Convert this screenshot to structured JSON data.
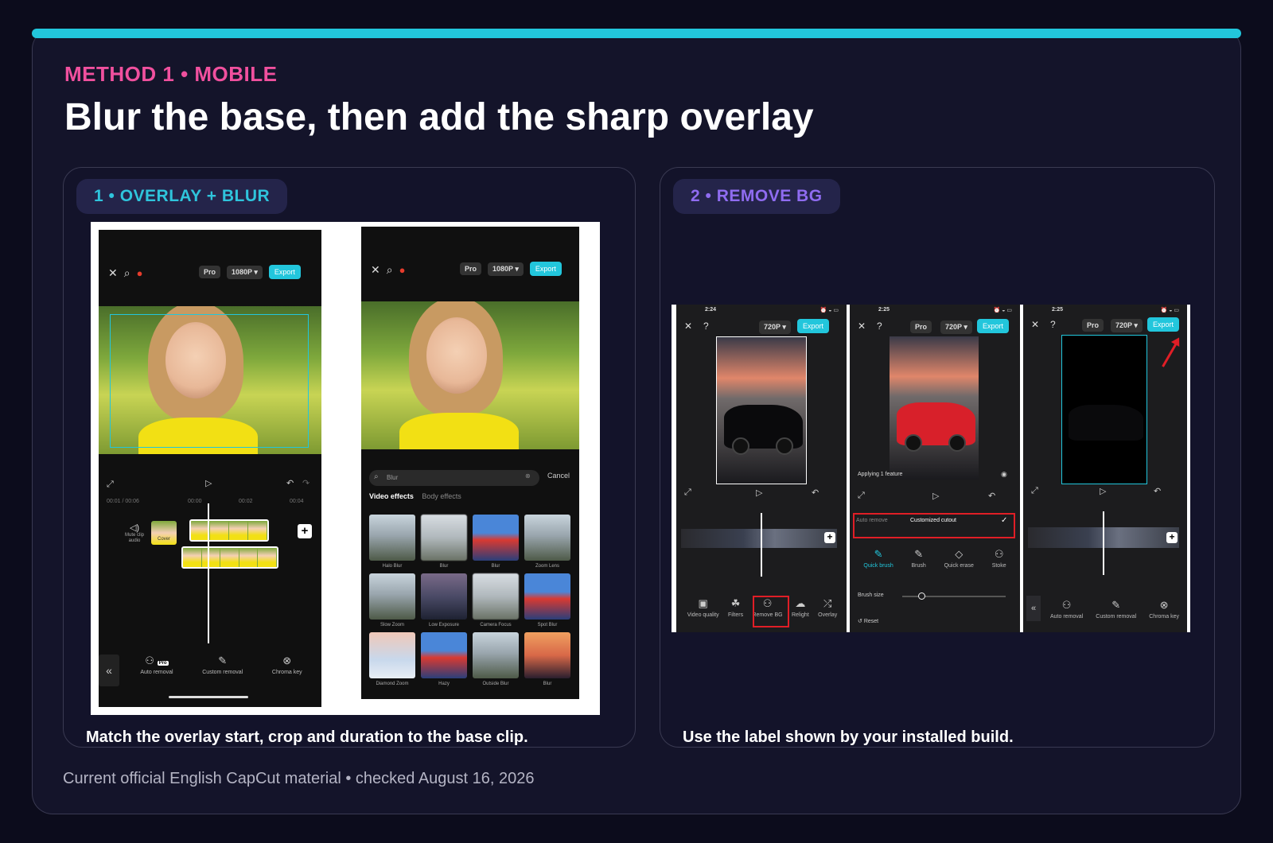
{
  "eyebrow": "METHOD 1 • MOBILE",
  "title": "Blur the base, then add the sharp overlay",
  "panels": [
    {
      "pill": "1 • OVERLAY + BLUR",
      "caption": "Match the overlay start, crop and duration to the base clip."
    },
    {
      "pill": "2 • REMOVE BG",
      "caption": "Use the label shown by your installed build."
    }
  ],
  "footer": "Current official English CapCut material • checked August 16, 2026",
  "colors": {
    "accent_bar": "#22c6dc",
    "eyebrow": "#f0509e",
    "pill1": "#2fc4dc",
    "pill2": "#8f6cf0",
    "highlight": "#e01e26"
  },
  "shotA": {
    "pro": "Pro",
    "resolution": "1080P ▾",
    "export": "Export",
    "time": "00:01 / 00:06",
    "marks": [
      "00:00",
      "00:02",
      "00:04"
    ],
    "mute": "Mute clip audio",
    "cover": "Cover",
    "nav": [
      {
        "icon": "auto-removal-icon",
        "label": "Auto removal",
        "pro": "Pro"
      },
      {
        "icon": "custom-removal-icon",
        "label": "Custom removal"
      },
      {
        "icon": "chroma-key-icon",
        "label": "Chroma key"
      }
    ]
  },
  "shotB": {
    "pro": "Pro",
    "resolution": "1080P ▾",
    "export": "Export",
    "search": "Blur",
    "cancel": "Cancel",
    "tab_on": "Video effects",
    "tab_off": "Body effects",
    "effects": [
      "Halo Blur",
      "Blur",
      "Blur",
      "Zoom Lens",
      "Slow Zoom",
      "Low Exposure",
      "Camera Focus",
      "Spot Blur",
      "Diamond Zoom",
      "Hazy",
      "Outside Blur",
      "Blur"
    ]
  },
  "removebg": {
    "phone1": {
      "time": "2:24",
      "resolution": "720P ▾",
      "export": "Export",
      "tools": [
        "Video quality",
        "Filters",
        "Remove BG",
        "Relight",
        "Overlay"
      ]
    },
    "phone2": {
      "time": "2:25",
      "pro": "Pro",
      "resolution": "720P ▾",
      "export": "Export",
      "applying": "Applying 1 feature",
      "tab_off": "Auto remove",
      "tab_on": "Customized cutout",
      "tools": [
        "Quick brush",
        "Brush",
        "Quick erase",
        "Stoke"
      ],
      "brush_size": "Brush size",
      "reset": "Reset"
    },
    "phone3": {
      "time": "2:25",
      "pro": "Pro",
      "resolution": "720P ▾",
      "export": "Export",
      "nav": [
        "Auto removal",
        "Custom removal",
        "Chroma key"
      ]
    }
  }
}
